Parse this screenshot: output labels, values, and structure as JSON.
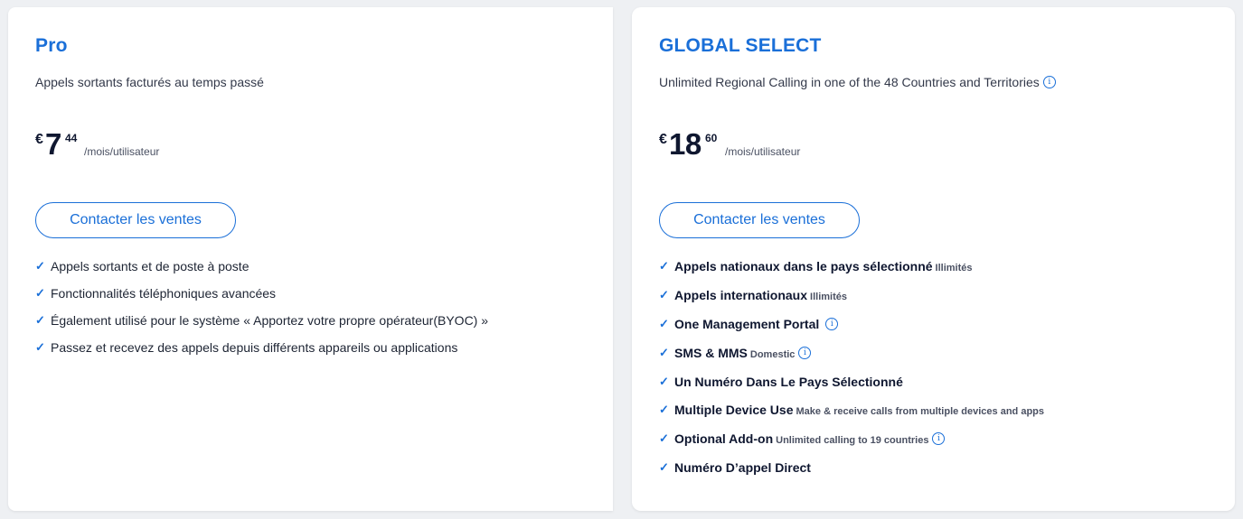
{
  "plans": {
    "pro": {
      "title": "Pro",
      "description": "Appels sortants facturés au temps passé",
      "price": {
        "currency": "€",
        "amount": "7",
        "cents": "44",
        "period": "/mois/utilisateur"
      },
      "cta_label": "Contacter les ventes",
      "features": [
        "Appels sortants et de poste à poste",
        "Fonctionnalités téléphoniques avancées",
        "Également utilisé pour le système « Apportez votre propre opérateur(BYOC) »",
        "Passez et recevez des appels depuis différents appareils ou applications"
      ]
    },
    "global": {
      "title": "GLOBAL SELECT",
      "description": "Unlimited Regional Calling in one of the 48 Countries and Territories",
      "price": {
        "currency": "€",
        "amount": "18",
        "cents": "60",
        "period": "/mois/utilisateur"
      },
      "cta_label": "Contacter les ventes",
      "features": [
        {
          "title": "Appels nationaux dans le pays sélectionné",
          "sub": "Illimités"
        },
        {
          "title": "Appels internationaux",
          "sub": "Illimités"
        },
        {
          "title": "One Management Portal",
          "sub": ""
        },
        {
          "title": "SMS & MMS",
          "sub": "Domestic"
        },
        {
          "title": "Un Numéro Dans Le Pays Sélectionné",
          "sub": ""
        },
        {
          "title": "Multiple Device Use",
          "sub": "Make & receive calls from multiple devices and apps"
        },
        {
          "title": "Optional Add-on",
          "sub": "Unlimited calling to 19 countries"
        },
        {
          "title": "Numéro D’appel Direct",
          "sub": ""
        }
      ]
    }
  },
  "icons": {
    "check": "✓",
    "info": "i"
  },
  "colors": {
    "accent": "#1a6fd8",
    "text_dark": "#0f1730",
    "background": "#eef0f3"
  }
}
